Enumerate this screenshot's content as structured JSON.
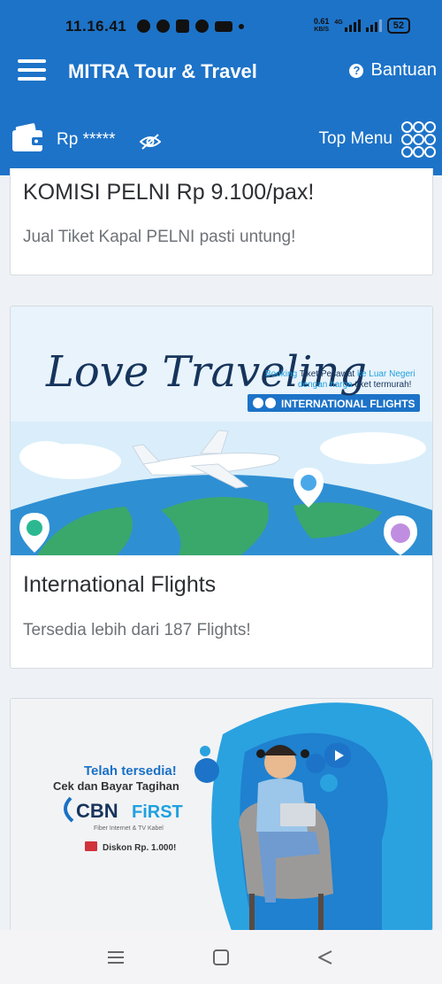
{
  "status": {
    "time": "11.16.41",
    "net_speed_value": "0.61",
    "net_speed_unit": "KB/S",
    "network": "4G",
    "battery": "52"
  },
  "header": {
    "title": "MITRA Tour & Travel",
    "help_label": "Bantuan",
    "balance": "Rp *****",
    "top_menu_label": "Top Menu"
  },
  "cards": [
    {
      "title": "KOMISI PELNI Rp 9.100/pax!",
      "subtitle": "Jual Tiket Kapal PELNI pasti untung!"
    },
    {
      "title": "International Flights",
      "subtitle": "Tersedia lebih dari 187 Flights!",
      "banner": {
        "headline": "Love Traveling",
        "line1_a": "Booking ",
        "line1_b": "Tiket Pesawat",
        "line1_c": " ke Luar Negeri",
        "line2_a": "dengan harga ",
        "line2_b": "tiket termurah!",
        "badge": "INTERNATIONAL FLIGHTS"
      }
    },
    {
      "banner": {
        "line1": "Telah tersedia!",
        "line2": "Cek dan Bayar Tagihan",
        "brand_a": "CBN",
        "brand_b": "FiRST",
        "brand_sub": "Fiber Internet & TV Kabel",
        "discount": "Diskon Rp. 1.000!"
      }
    }
  ],
  "colors": {
    "primary": "#1d73c8",
    "navy_text": "#16345c",
    "accent_blue": "#1fa1e0"
  }
}
